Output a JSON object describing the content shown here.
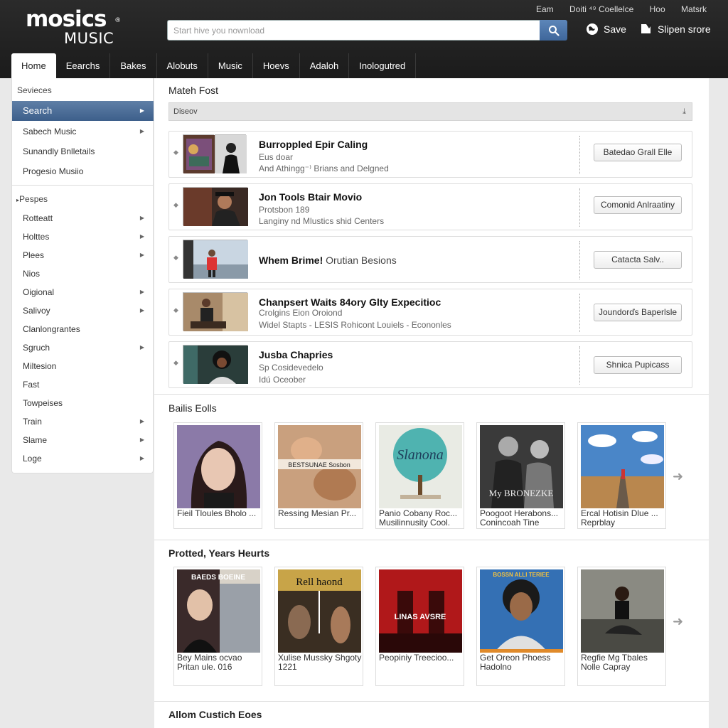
{
  "brand": {
    "logo_top": "mosics",
    "logo_sub": "MUSIC",
    "reg": "®"
  },
  "toplinks": [
    "Eam",
    "Doiti ⁴⁹ Coellelce",
    "Hoo",
    "Matsrk"
  ],
  "search": {
    "placeholder": "Start hive you nownload"
  },
  "header_actions": {
    "save": "Save",
    "signin": "Slipen srore"
  },
  "tabs": [
    "Home",
    "Eearchs",
    "Bakes",
    "Alobuts",
    "Music",
    "Hoevs",
    "Adaloh",
    "Inologutred"
  ],
  "sidebar": {
    "heading": "Sevieces",
    "top_items": [
      {
        "label": "Search",
        "chevron": true,
        "active": true
      },
      {
        "label": "Sabech Music",
        "chevron": true
      },
      {
        "label": "Sunandly Bnlletails",
        "chevron": false
      },
      {
        "label": "Progesio Musiio",
        "chevron": false
      }
    ],
    "group_heading": "Pespes",
    "items": [
      {
        "label": "Rotteatt",
        "chevron": true
      },
      {
        "label": "Holttes",
        "chevron": true
      },
      {
        "label": "Plees",
        "chevron": true
      },
      {
        "label": "Nios",
        "chevron": false
      },
      {
        "label": "Oigional",
        "chevron": true
      },
      {
        "label": "Salivoy",
        "chevron": true
      },
      {
        "label": "Clanlongrantes",
        "chevron": false
      },
      {
        "label": "Sgruch",
        "chevron": true
      },
      {
        "label": "Miltesion",
        "chevron": false
      },
      {
        "label": "Fast",
        "chevron": false
      },
      {
        "label": "Towpeises",
        "chevron": false
      },
      {
        "label": "Train",
        "chevron": true
      },
      {
        "label": "Slame",
        "chevron": true
      },
      {
        "label": "Loge",
        "chevron": true
      }
    ]
  },
  "results_section": {
    "title": "Mateh Fost",
    "filter_label": "Diseov",
    "rows": [
      {
        "title": "Burroppled Epir Caling",
        "title_rest": "",
        "sub1": "Eus doar",
        "sub2": "And Athingg⁻⁾ Brians and Delgned",
        "button": "Batedao Grall Elle"
      },
      {
        "title": "Jon Tools Btair Movio",
        "title_rest": "",
        "sub1": "Protsbon 189",
        "sub2": "Langiny nd Mlustics shid Centers",
        "button": "Comonid Anlraatiny"
      },
      {
        "title": "Whem Brime!",
        "title_rest": "Orutian Besions",
        "sub1": "",
        "sub2": "",
        "button": "Catacta Salv.."
      },
      {
        "title": "Chanpsert Waits 84ory Glty Expecitioc",
        "title_rest": "",
        "sub1": "Crolgins Eion Oroiond",
        "sub2": "Widel Stapts - LESIS Rohicont Louiels - Econonles",
        "button": "Joundorďs Baperlsle"
      },
      {
        "title": "Jusba Chapries",
        "title_rest": "",
        "sub1": "Sp Cosidevedelo",
        "sub2": "Idú Oceober",
        "button": "Shnica Pupicass"
      }
    ]
  },
  "albums_section": {
    "title": "Bailis Eolls",
    "cards": [
      {
        "caption": "Fieil Tloules Bholo ..."
      },
      {
        "caption": "Ressing Mesian Pr...",
        "art_text": "BESTSUNAE Sosbon"
      },
      {
        "caption": "Panio Cobany Roc... Musilinnusity Cool.",
        "art_text": "Slanona"
      },
      {
        "caption": "Poogoot Herabons... Conincoah Tine",
        "art_text": "My BRONEZKE"
      },
      {
        "caption": "Ercal Hotisin Dlue ... Reprblay"
      }
    ]
  },
  "promoted_section": {
    "title": "Protted, Years Heurts",
    "cards": [
      {
        "caption": "Bey Mains ocvao Pritan ule. 016",
        "art_text": "BAEDS BOEINE"
      },
      {
        "caption": "Xulise Mussky Shgoty 1221",
        "art_text": "Rell haond"
      },
      {
        "caption": "Peopiniy Treecioo...",
        "art_text": "LINAS AVSRE"
      },
      {
        "caption": "Get Oreon Phoess Hadolno",
        "art_text": "BOSSN ALLI TERIEE"
      },
      {
        "caption": "Regfie Mg Tbales Nolle Capray"
      }
    ]
  },
  "bottom_section": {
    "title": "Allom Custich Eoes"
  }
}
